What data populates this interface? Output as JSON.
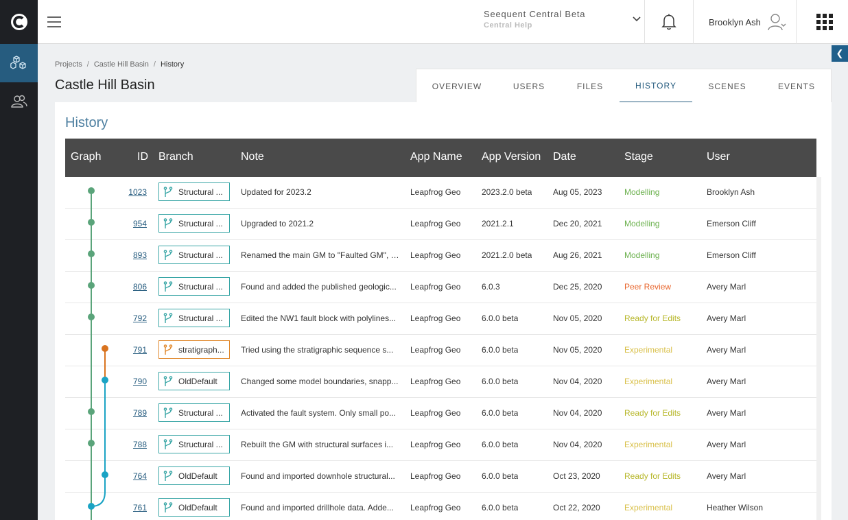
{
  "header": {
    "org_name": "Seequent Central Beta",
    "org_sub": "Central Help",
    "user_name": "Brooklyn Ash"
  },
  "breadcrumb": [
    "Projects",
    "Castle Hill Basin",
    "History"
  ],
  "page_title": "Castle Hill Basin",
  "tabs": [
    "OVERVIEW",
    "USERS",
    "FILES",
    "HISTORY",
    "SCENES",
    "EVENTS"
  ],
  "active_tab": "HISTORY",
  "section_title": "History",
  "table": {
    "columns": [
      "Graph",
      "ID",
      "Branch",
      "Note",
      "App Name",
      "App Version",
      "Date",
      "Stage",
      "User"
    ],
    "rows": [
      {
        "id": "1023",
        "branch": "Structural ...",
        "branch_color": "teal",
        "note": "Updated for 2023.2",
        "app": "Leapfrog Geo",
        "version": "2023.2.0 beta",
        "date": "Aug 05, 2023",
        "stage": "Modelling",
        "stage_color": "#6ab04c",
        "user": "Brooklyn Ash"
      },
      {
        "id": "954",
        "branch": "Structural ...",
        "branch_color": "teal",
        "note": "Upgraded to 2021.2",
        "app": "Leapfrog Geo",
        "version": "2021.2.1",
        "date": "Dec 20, 2021",
        "stage": "Modelling",
        "stage_color": "#6ab04c",
        "user": "Emerson Cliff"
      },
      {
        "id": "893",
        "branch": "Structural ...",
        "branch_color": "teal",
        "note": "Renamed the main GM to \"Faulted GM\", a...",
        "app": "Leapfrog Geo",
        "version": "2021.2.0 beta",
        "date": "Aug 26, 2021",
        "stage": "Modelling",
        "stage_color": "#6ab04c",
        "user": "Emerson Cliff"
      },
      {
        "id": "806",
        "branch": "Structural ...",
        "branch_color": "teal",
        "note": "Found and added the published geologic...",
        "app": "Leapfrog Geo",
        "version": "6.0.3",
        "date": "Dec 25, 2020",
        "stage": "Peer Review",
        "stage_color": "#e8652c",
        "user": "Avery Marl"
      },
      {
        "id": "792",
        "branch": "Structural ...",
        "branch_color": "teal",
        "note": "Edited the NW1 fault block with polylines...",
        "app": "Leapfrog Geo",
        "version": "6.0.0 beta",
        "date": "Nov 05, 2020",
        "stage": "Ready for Edits",
        "stage_color": "#b7b72a",
        "user": "Avery Marl"
      },
      {
        "id": "791",
        "branch": "stratigraph...",
        "branch_color": "orange",
        "note": "Tried using the stratigraphic sequence s...",
        "app": "Leapfrog Geo",
        "version": "6.0.0 beta",
        "date": "Nov 05, 2020",
        "stage": "Experimental",
        "stage_color": "#d9c04a",
        "user": "Avery Marl"
      },
      {
        "id": "790",
        "branch": "OldDefault",
        "branch_color": "teal",
        "note": "Changed some model boundaries, snapp...",
        "app": "Leapfrog Geo",
        "version": "6.0.0 beta",
        "date": "Nov 04, 2020",
        "stage": "Experimental",
        "stage_color": "#d9c04a",
        "user": "Avery Marl"
      },
      {
        "id": "789",
        "branch": "Structural ...",
        "branch_color": "teal",
        "note": "Activated the fault system. Only small po...",
        "app": "Leapfrog Geo",
        "version": "6.0.0 beta",
        "date": "Nov 04, 2020",
        "stage": "Ready for Edits",
        "stage_color": "#b7b72a",
        "user": "Avery Marl"
      },
      {
        "id": "788",
        "branch": "Structural ...",
        "branch_color": "teal",
        "note": "Rebuilt the GM with structural surfaces i...",
        "app": "Leapfrog Geo",
        "version": "6.0.0 beta",
        "date": "Nov 04, 2020",
        "stage": "Experimental",
        "stage_color": "#d9c04a",
        "user": "Avery Marl"
      },
      {
        "id": "764",
        "branch": "OldDefault",
        "branch_color": "teal",
        "note": "Found and imported downhole structural...",
        "app": "Leapfrog Geo",
        "version": "6.0.0 beta",
        "date": "Oct 23, 2020",
        "stage": "Ready for Edits",
        "stage_color": "#b7b72a",
        "user": "Avery Marl"
      },
      {
        "id": "761",
        "branch": "OldDefault",
        "branch_color": "teal",
        "note": "Found and imported drillhole data. Adde...",
        "app": "Leapfrog Geo",
        "version": "6.0.0 beta",
        "date": "Oct 22, 2020",
        "stage": "Experimental",
        "stage_color": "#d9c04a",
        "user": "Heather Wilson"
      }
    ]
  }
}
